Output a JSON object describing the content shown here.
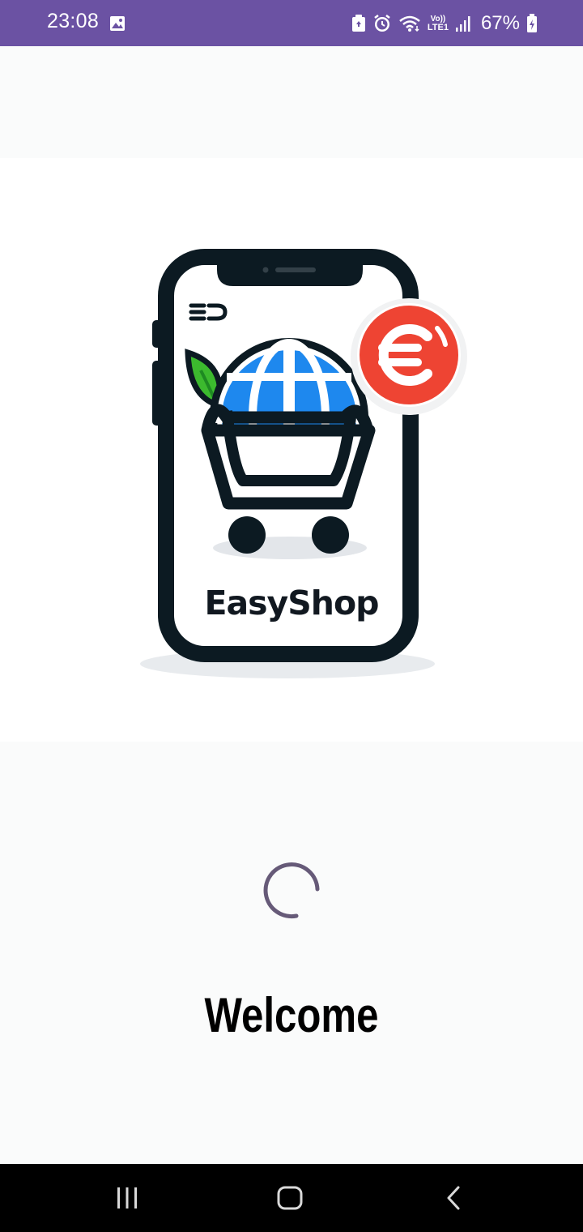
{
  "status_bar": {
    "time": "23:08",
    "battery": "67%",
    "icons": [
      "gallery-icon",
      "recycle-icon",
      "alarm-icon",
      "wifi-icon",
      "volte-icon",
      "signal-icon",
      "battery-icon"
    ],
    "volte_label_top": "Vo))",
    "volte_label_bottom": "LTE1",
    "background": "#6b52a3"
  },
  "logo": {
    "brand_name": "EasyShop",
    "currency_symbol": "€",
    "colors": {
      "outline": "#0c1a22",
      "globe": "#1e88ee",
      "badge": "#ee4433",
      "leaf": "#3cba2e"
    }
  },
  "loading": {
    "spinner_color": "#665a78"
  },
  "welcome_text": "Welcome",
  "nav_bar": {
    "buttons": [
      "recent-apps-icon",
      "home-icon",
      "back-icon"
    ]
  }
}
